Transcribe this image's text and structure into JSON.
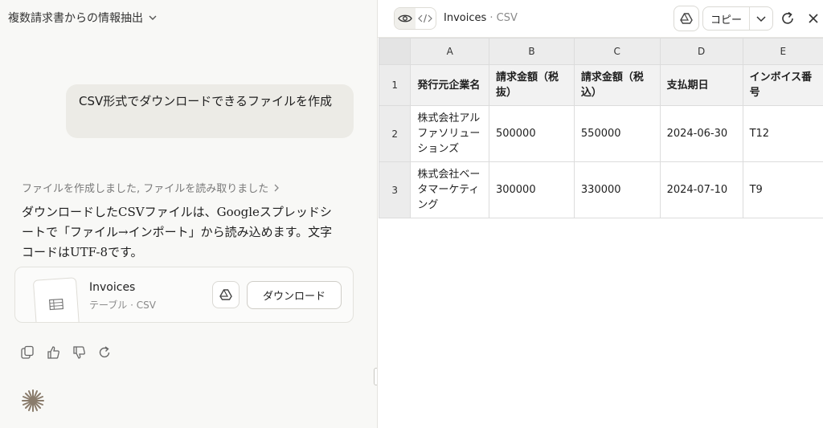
{
  "chat": {
    "title": "複数請求書からの情報抽出",
    "user_message": "CSV形式でダウンロードできるファイルを作成",
    "tool_status": "ファイルを作成しました, ファイルを読み取りました",
    "assistant_text": "ダウンロードしたCSVファイルは、Googleスプレッドシートで「ファイル→インポート」から読み込めます。文字コードはUTF-8です。",
    "file_card": {
      "name": "Invoices",
      "meta": "テーブル · CSV",
      "download_label": "ダウンロード"
    }
  },
  "artifact": {
    "title": "Invoices",
    "subtitle": "· CSV",
    "copy_label": "コピー"
  },
  "sheet": {
    "columns": [
      "A",
      "B",
      "C",
      "D",
      "E"
    ],
    "rows": [
      {
        "num": "1",
        "cells": [
          "発行元企業名",
          "請求金額（税抜）",
          "請求金額（税込）",
          "支払期日",
          "インボイス番号"
        ]
      },
      {
        "num": "2",
        "cells": [
          "株式会社アルファソリューションズ",
          "500000",
          "550000",
          "2024-06-30",
          "T12"
        ]
      },
      {
        "num": "3",
        "cells": [
          "株式会社ベータマーケティング",
          "300000",
          "330000",
          "2024-07-10",
          "T9"
        ]
      }
    ]
  },
  "colors": {
    "accent": "#1f1f1f",
    "bubble": "#ecebe6",
    "sheet_header": "#ececec"
  }
}
